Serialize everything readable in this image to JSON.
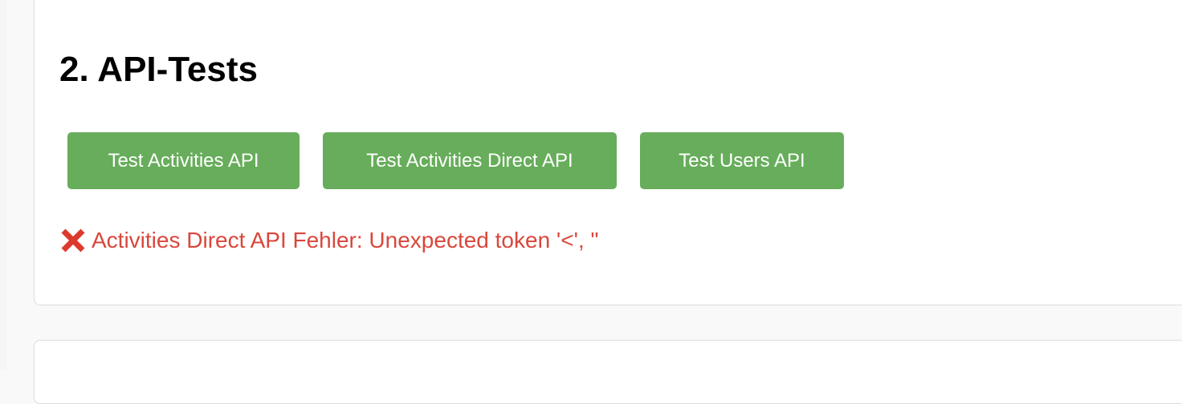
{
  "section": {
    "title": "2. API-Tests"
  },
  "buttons": [
    {
      "label": "Test Activities API"
    },
    {
      "label": "Test Activities Direct API"
    },
    {
      "label": "Test Users API"
    }
  ],
  "result": {
    "icon": "cross-mark-icon",
    "message": "Activities Direct API Fehler: Unexpected token '<', \""
  },
  "colors": {
    "button_bg": "#67ad5b",
    "button_text": "#ffffff",
    "error_text": "#d9473c",
    "error_icon": "#dc3a2e",
    "panel_border": "#dddddd"
  }
}
